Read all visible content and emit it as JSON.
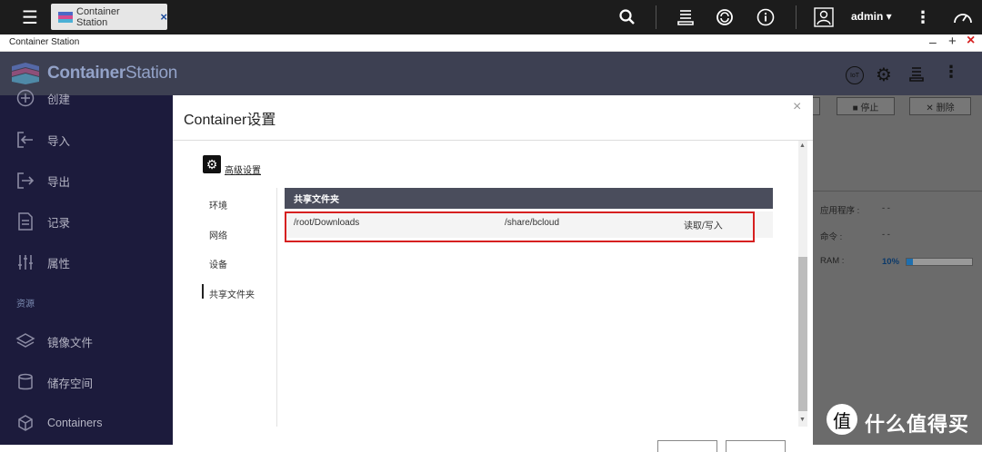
{
  "topbar": {
    "tab_label": "Container Station",
    "tab_close": "×",
    "user_name": "admin ▾"
  },
  "window": {
    "title": "Container Station",
    "minimize": "–",
    "maximize": "+",
    "close": "×"
  },
  "app": {
    "name_bold": "Container",
    "name_rest": "Station"
  },
  "sidebar": {
    "items": [
      {
        "label": "创建",
        "icon": "plus-circle-icon"
      },
      {
        "label": "导入",
        "icon": "import-icon"
      },
      {
        "label": "导出",
        "icon": "export-icon"
      },
      {
        "label": "记录",
        "icon": "document-icon"
      },
      {
        "label": "属性",
        "icon": "sliders-icon"
      }
    ],
    "section_label": "资源",
    "resources": [
      {
        "label": "镜像文件",
        "icon": "layers-icon"
      },
      {
        "label": "储存空间",
        "icon": "database-icon"
      },
      {
        "label": "Containers",
        "icon": "cube-icon"
      }
    ]
  },
  "background": {
    "stop_label": "■ 停止",
    "delete_label": "✕ 删除",
    "rows": [
      {
        "key": "应用程序 :",
        "value": "- -"
      },
      {
        "key": "命令 :",
        "value": "- -"
      },
      {
        "key": "RAM :",
        "value": "10%"
      }
    ],
    "ram_percent": 10
  },
  "modal": {
    "title": "Container设置",
    "close": "×",
    "advanced_label": "高级设置",
    "nav": [
      "环境",
      "网络",
      "设备",
      "共享文件夹"
    ],
    "active_nav": "共享文件夹",
    "table_header": "共享文件夹",
    "row": {
      "container_path": "/root/Downloads",
      "host_path": "/share/bcloud",
      "permission": "读取/写入"
    }
  },
  "watermark": {
    "logo": "值",
    "text": "什么值得买"
  },
  "colors": {
    "highlight": "#d62020",
    "sidebar": "#1c1b3c",
    "accent_blue": "#1f6fae"
  }
}
